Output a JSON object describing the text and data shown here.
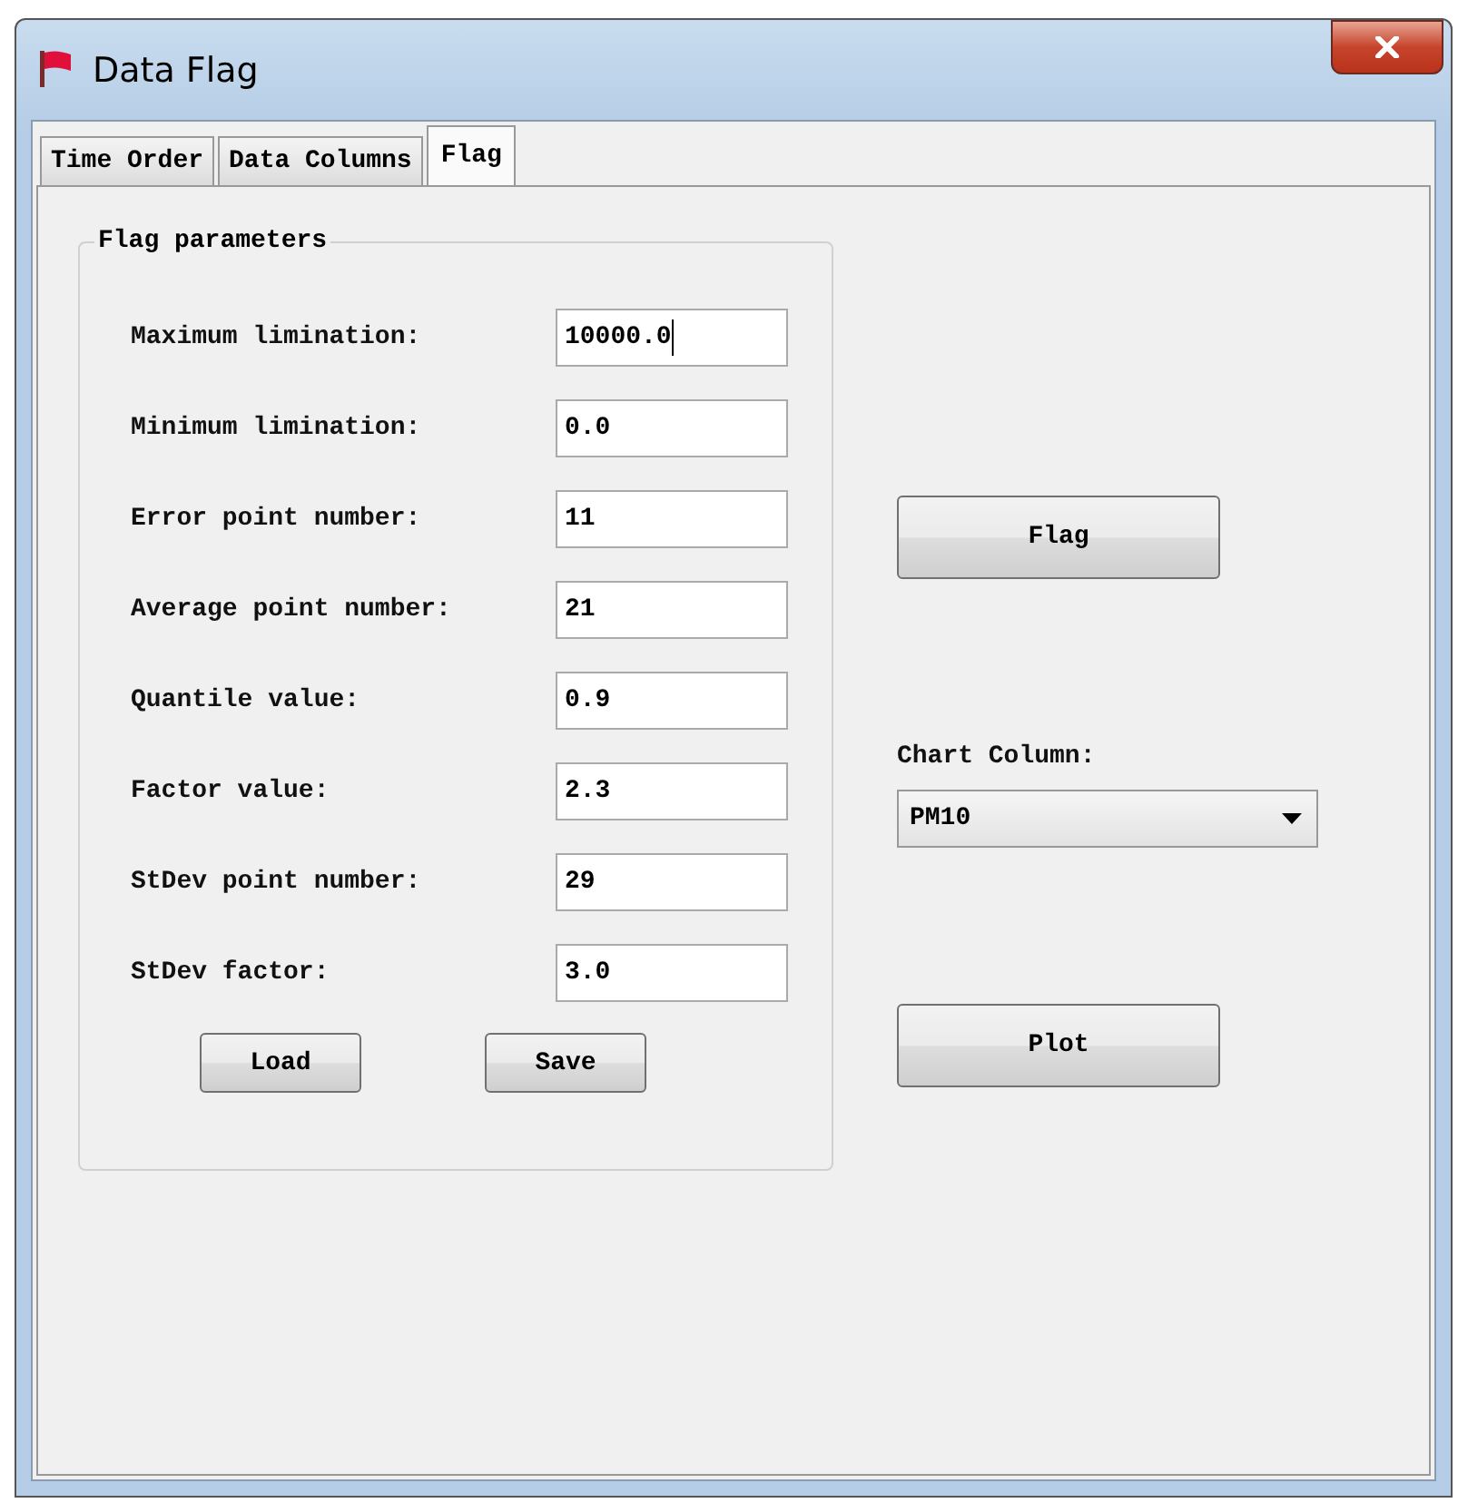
{
  "window": {
    "title": "Data Flag"
  },
  "tabs": [
    {
      "label": "Time Order",
      "selected": false
    },
    {
      "label": "Data Columns",
      "selected": false
    },
    {
      "label": "Flag",
      "selected": true
    }
  ],
  "flag_parameters": {
    "title": "Flag parameters",
    "fields": [
      {
        "label": "Maximum limination:",
        "value": "10000.0",
        "focused": true
      },
      {
        "label": "Minimum limination:",
        "value": "0.0",
        "focused": false
      },
      {
        "label": "Error point number:",
        "value": "11",
        "focused": false
      },
      {
        "label": "Average point number:",
        "value": "21",
        "focused": false
      },
      {
        "label": "Quantile value:",
        "value": "0.9",
        "focused": false
      },
      {
        "label": "Factor value:",
        "value": "2.3",
        "focused": false
      },
      {
        "label": "StDev point number:",
        "value": "29",
        "focused": false
      },
      {
        "label": "StDev factor:",
        "value": "3.0",
        "focused": false
      }
    ],
    "buttons": [
      "Load",
      "Save"
    ]
  },
  "flag_button": "Flag",
  "chart_column": {
    "label": "Chart Column:",
    "value": "PM10"
  },
  "plot_button": "Plot"
}
